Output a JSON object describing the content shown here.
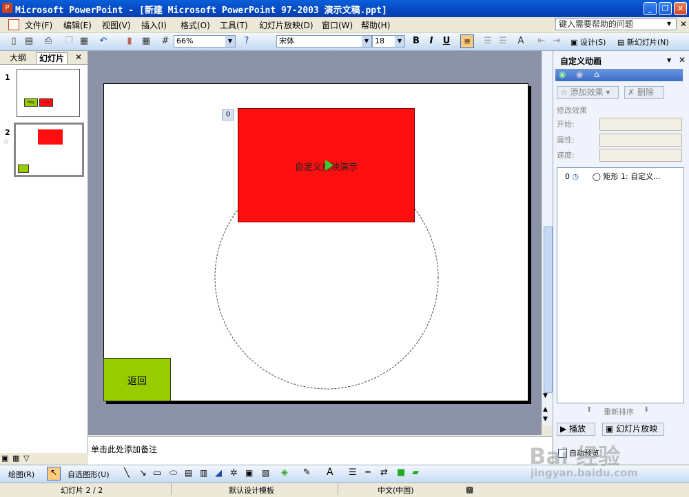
{
  "window": {
    "title": "Microsoft PowerPoint - [新建 Microsoft PowerPoint 97-2003 演示文稿.ppt]"
  },
  "menu": [
    "文件(F)",
    "编辑(E)",
    "视图(V)",
    "插入(I)",
    "格式(O)",
    "工具(T)",
    "幻灯片放映(D)",
    "窗口(W)",
    "帮助(H)"
  ],
  "help_placeholder": "键入需要帮助的问题",
  "toolbar": {
    "zoom": "66%",
    "font": "宋体",
    "font_size": "18",
    "bold": "B",
    "italic": "I",
    "underline": "U",
    "design": "设计(S)",
    "new_slide": "新幻灯片(N)"
  },
  "left_tabs": {
    "outline": "大纲",
    "slides": "幻灯片"
  },
  "thumbnails": [
    {
      "num": "1",
      "box1": "Hey",
      "box2": "→→"
    },
    {
      "num": "2"
    }
  ],
  "slide": {
    "red_text": "自定义放映演示",
    "green_text": "返回",
    "anim_tag": "0"
  },
  "notes": "单击此处添加备注",
  "pane": {
    "title": "自定义动画",
    "add_effect": "添加效果",
    "delete": "删除",
    "modify": "修改效果",
    "start": "开始:",
    "property": "属性:",
    "speed": "速度:",
    "list_item_num": "0",
    "list_item_text": "矩形 1: 自定义...",
    "reorder": "重新排序",
    "play": "播放",
    "slideshow": "幻灯片放映",
    "autopreview": "自动预览"
  },
  "drawbar": {
    "draw": "绘图(R)",
    "autoshapes": "自选图形(U)"
  },
  "status": {
    "slide": "幻灯片 2 / 2",
    "template": "默认设计模板",
    "lang": "中文(中国)"
  },
  "watermark": {
    "main": "Bai 经验",
    "url": "jingyan.baidu.com"
  },
  "colors": {
    "title_bar": "#0548c2",
    "red_shape": "#fe0e0e",
    "green_shape": "#99cc00",
    "slide_bg": "#8c93a8"
  }
}
